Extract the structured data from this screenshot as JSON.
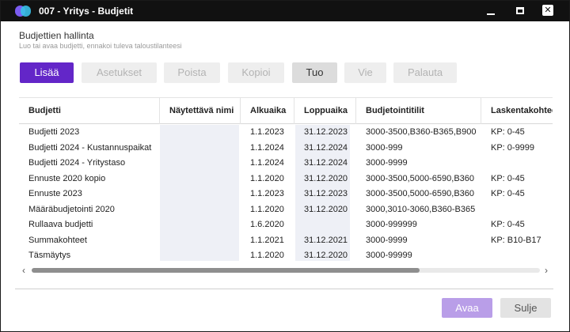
{
  "window": {
    "title": "007 - Yritys - Budjetit",
    "controls": {
      "minimize": "minimize-icon",
      "maximize": "maximize-icon",
      "close": "close-icon",
      "close_glyph": "✕"
    }
  },
  "header": {
    "title": "Budjettien hallinta",
    "subtitle": "Luo tai avaa budjetti, ennakoi tuleva taloustilanteesi"
  },
  "toolbar": {
    "add": "Lisää",
    "settings": "Asetukset",
    "delete": "Poista",
    "copy": "Kopioi",
    "import": "Tuo",
    "export": "Vie",
    "restore": "Palauta"
  },
  "table": {
    "columns": [
      "Budjetti",
      "Näytettävä nimi",
      "Alkuaika",
      "Loppuaika",
      "Budjetointitilit",
      "Laskentakohteet"
    ],
    "rows": [
      [
        "Budjetti 2023",
        "",
        "1.1.2023",
        "31.12.2023",
        "3000-3500,B360-B365,B900",
        "KP: 0-45"
      ],
      [
        "Budjetti 2024 - Kustannuspaikat",
        "",
        "1.1.2024",
        "31.12.2024",
        "3000-999",
        "KP: 0-9999"
      ],
      [
        "Budjetti 2024 - Yritystaso",
        "",
        "1.1.2024",
        "31.12.2024",
        "3000-9999",
        ""
      ],
      [
        "Ennuste 2020 kopio",
        "",
        "1.1.2020",
        "31.12.2020",
        "3000-3500,5000-6590,B360",
        "KP: 0-45"
      ],
      [
        "Ennuste 2023",
        "",
        "1.1.2023",
        "31.12.2023",
        "3000-3500,5000-6590,B360",
        "KP: 0-45"
      ],
      [
        "Määräbudjetointi 2020",
        "",
        "1.1.2020",
        "31.12.2020",
        "3000,3010-3060,B360-B365",
        ""
      ],
      [
        "Rullaava budjetti",
        "",
        "1.6.2020",
        "",
        "3000-999999",
        "KP: 0-45"
      ],
      [
        "Summakohteet",
        "",
        "1.1.2021",
        "31.12.2021",
        "3000-9999",
        "KP: B10-B17"
      ],
      [
        "Täsmäytys",
        "",
        "1.1.2020",
        "31.12.2020",
        "3000-99999",
        ""
      ]
    ]
  },
  "scrollbar": {
    "left_arrow": "‹",
    "right_arrow": "›"
  },
  "footer": {
    "open": "Avaa",
    "close": "Sulje"
  }
}
